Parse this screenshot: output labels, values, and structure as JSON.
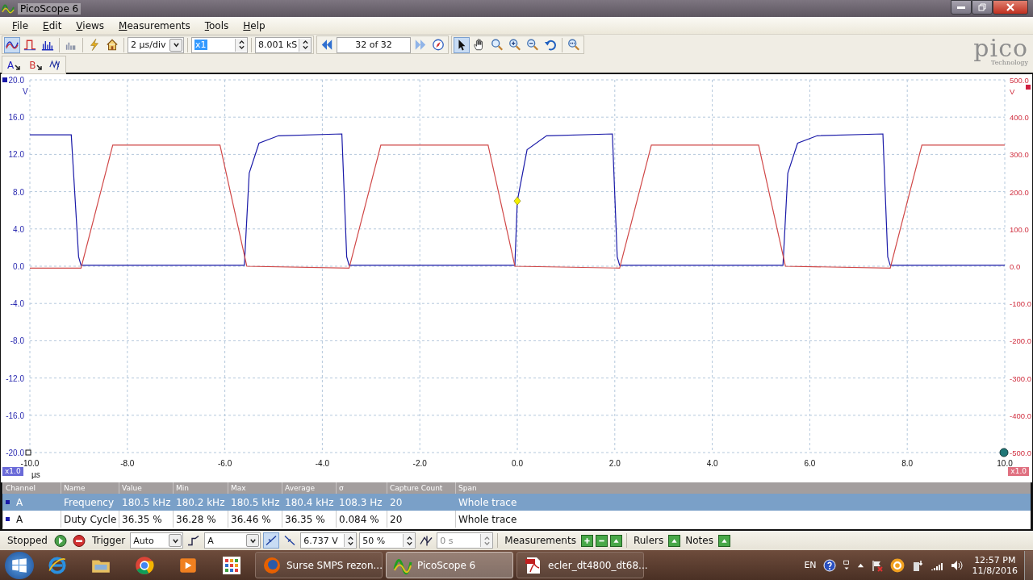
{
  "window": {
    "title": "PicoScope 6"
  },
  "menu": [
    "File",
    "Edit",
    "Views",
    "Measurements",
    "Tools",
    "Help"
  ],
  "toolbar": {
    "timebase": "2 µs/div",
    "zoom": "x1",
    "samples": "8.001 kS",
    "buffer": "32 of 32"
  },
  "channel_buttons": [
    {
      "label": "A",
      "color": "#2020c0"
    },
    {
      "label": "B",
      "color": "#d03030"
    }
  ],
  "logo": {
    "name": "pico",
    "tagline": "Technology"
  },
  "scope": {
    "range_left": "x1.0",
    "range_right": "x1.0",
    "chart_data": {
      "type": "line",
      "xlabel": "µs",
      "ylabel": "V",
      "y2label": "V",
      "xlim": [
        -10,
        10
      ],
      "ylim": [
        -20,
        20
      ],
      "y2lim": [
        -500,
        500
      ],
      "xticks": [
        {
          "value": -10,
          "label": "-10.0"
        },
        {
          "value": -8,
          "label": "-8.0"
        },
        {
          "value": -6,
          "label": "-6.0"
        },
        {
          "value": -4,
          "label": "-4.0"
        },
        {
          "value": -2,
          "label": "-2.0"
        },
        {
          "value": 0,
          "label": "0.0"
        },
        {
          "value": 2,
          "label": "2.0"
        },
        {
          "value": 4,
          "label": "4.0"
        },
        {
          "value": 6,
          "label": "6.0"
        },
        {
          "value": 8,
          "label": "8.0"
        },
        {
          "value": 10,
          "label": "10.0"
        }
      ],
      "yticks": [
        {
          "value": 20,
          "label": "20.0"
        },
        {
          "value": 16,
          "label": "16.0"
        },
        {
          "value": 12,
          "label": "12.0"
        },
        {
          "value": 8,
          "label": "8.0"
        },
        {
          "value": 4,
          "label": "4.0"
        },
        {
          "value": 0,
          "label": "0.0"
        },
        {
          "value": -4,
          "label": "-4.0"
        },
        {
          "value": -8,
          "label": "-8.0"
        },
        {
          "value": -12,
          "label": "-12.0"
        },
        {
          "value": -16,
          "label": "-16.0"
        },
        {
          "value": -20,
          "label": "-20.0"
        }
      ],
      "y2ticks": [
        {
          "value": 500,
          "label": "500.0"
        },
        {
          "value": 400,
          "label": "400.0"
        },
        {
          "value": 300,
          "label": "300.0"
        },
        {
          "value": 200,
          "label": "200.0"
        },
        {
          "value": 100,
          "label": "100.0"
        },
        {
          "value": 0,
          "label": "0.0"
        },
        {
          "value": -100,
          "label": "-100.0"
        },
        {
          "value": -200,
          "label": "-200.0"
        },
        {
          "value": -300,
          "label": "-300.0"
        },
        {
          "value": -400,
          "label": "-400.0"
        },
        {
          "value": -500,
          "label": "-500.0"
        }
      ],
      "series": [
        {
          "color": "#1a1aa8",
          "x": [
            -10,
            -9.15,
            -9.0,
            -8.95,
            -5.6,
            -5.5,
            -5.3,
            -4.9,
            -3.6,
            -3.5,
            -3.45,
            -0.05,
            0,
            0.2,
            0.6,
            1.95,
            2.05,
            2.1,
            5.45,
            5.55,
            5.75,
            6.15,
            7.5,
            7.6,
            7.65,
            10
          ],
          "values": [
            14.1,
            14.1,
            1.0,
            0.1,
            0.1,
            10,
            13.2,
            14,
            14.2,
            1,
            0.1,
            0.1,
            7,
            12.5,
            14,
            14.2,
            1,
            0.1,
            0.1,
            10,
            13.2,
            14,
            14.2,
            1,
            0.1,
            0.1
          ]
        },
        {
          "color": "#d04848",
          "axis": "y2",
          "x": [
            -10,
            -8.95,
            -8.3,
            -6.1,
            -5.55,
            -3.45,
            -2.8,
            -0.6,
            -0.05,
            2.1,
            2.75,
            4.95,
            5.5,
            7.65,
            8.3,
            10
          ],
          "values": [
            -5,
            -5,
            325,
            325,
            0,
            -5,
            325,
            325,
            0,
            -5,
            325,
            325,
            0,
            -5,
            325,
            325
          ]
        }
      ],
      "grid": true
    }
  },
  "measurements": {
    "columns": [
      "Channel",
      "Name",
      "Value",
      "Min",
      "Max",
      "Average",
      "σ",
      "Capture Count",
      "Span"
    ],
    "rows": [
      {
        "selected": true,
        "cells": [
          "A",
          "Frequency",
          "180.5 kHz",
          "180.2 kHz",
          "180.5 kHz",
          "180.4 kHz",
          "108.3 Hz",
          "20",
          "Whole trace"
        ]
      },
      {
        "selected": false,
        "cells": [
          "A",
          "Duty Cycle",
          "36.35 %",
          "36.28 %",
          "36.46 %",
          "36.35 %",
          "0.084 %",
          "20",
          "Whole trace"
        ]
      }
    ]
  },
  "status_bar": {
    "state": "Stopped",
    "trigger_label": "Trigger",
    "trigger_mode": "Auto",
    "source": "A",
    "threshold": "6.737 V",
    "pretrigger": "50 %",
    "delay": "0 s",
    "measurements_label": "Measurements",
    "rulers_label": "Rulers",
    "notes_label": "Notes"
  },
  "taskbar": {
    "tasks": [
      {
        "label": "Surse SMPS rezon...",
        "kind": "firefox",
        "selected": false
      },
      {
        "label": "PicoScope 6",
        "kind": "pico",
        "selected": true
      },
      {
        "label": "ecler_dt4800_dt68...",
        "kind": "pdf",
        "selected": false
      }
    ],
    "language": "EN",
    "time": "12:57 PM",
    "date": "11/8/2016"
  }
}
